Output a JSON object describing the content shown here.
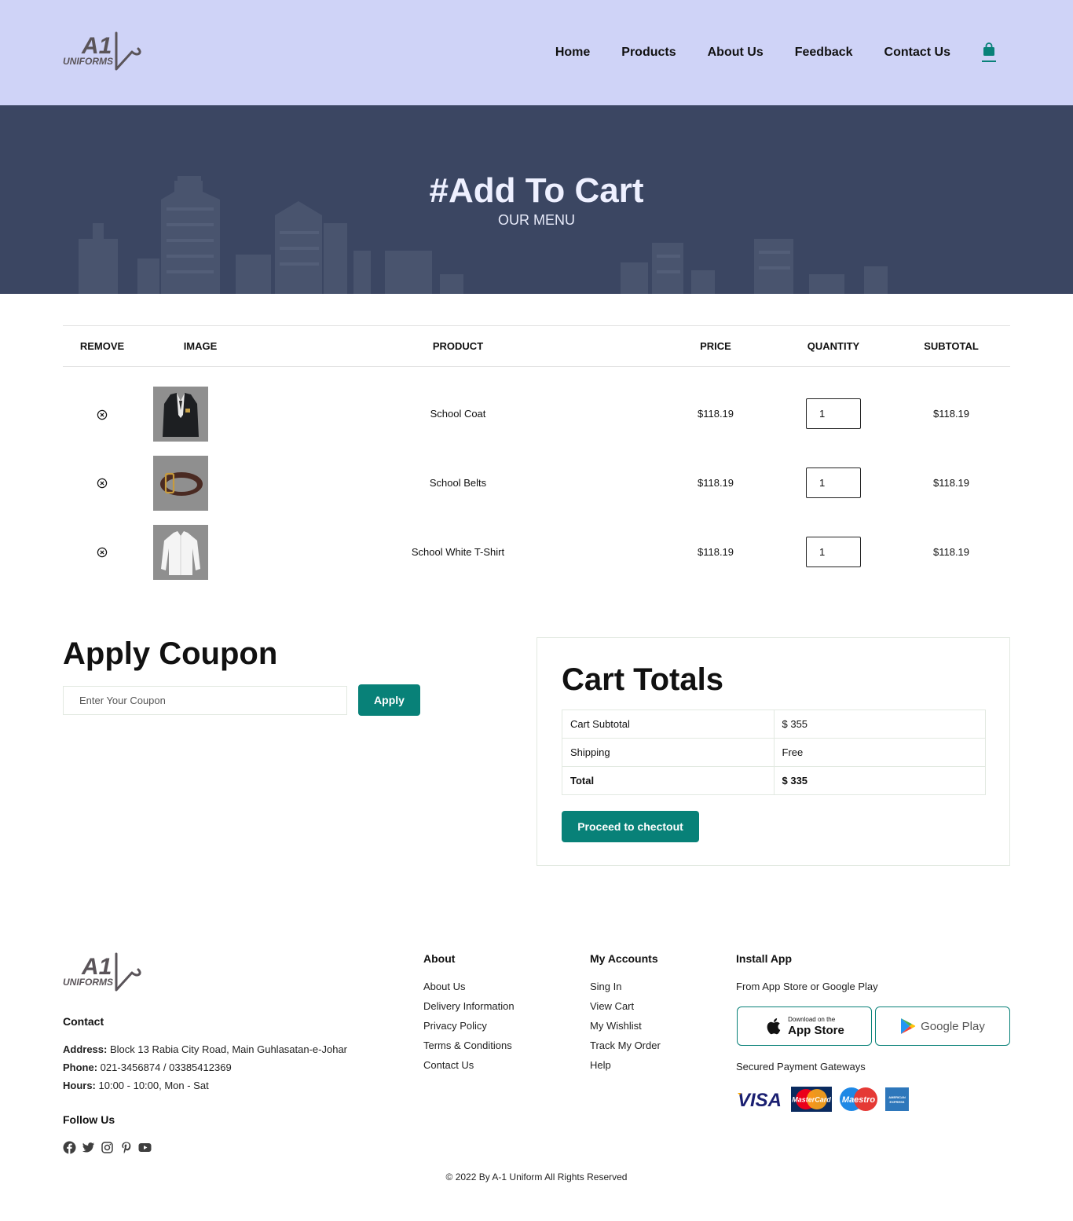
{
  "brand": {
    "logo_big": "A1",
    "logo_small": "UNIFORMS"
  },
  "nav": {
    "items": [
      "Home",
      "Products",
      "About Us",
      "Feedback",
      "Contact Us"
    ],
    "cart_icon": "shopping-bag-icon"
  },
  "hero": {
    "title": "#Add To Cart",
    "subtitle": "OUR MENU"
  },
  "cart": {
    "headers": [
      "REMOVE",
      "IMAGE",
      "PRODUCT",
      "PRICE",
      "QUANTITY",
      "SUBTOTAL"
    ],
    "rows": [
      {
        "product": "School Coat",
        "price": "$118.19",
        "quantity": "1",
        "subtotal": "$118.19",
        "image": "school-coat"
      },
      {
        "product": "School Belts",
        "price": "$118.19",
        "quantity": "1",
        "subtotal": "$118.19",
        "image": "school-belt"
      },
      {
        "product": "School White T-Shirt",
        "price": "$118.19",
        "quantity": "1",
        "subtotal": "$118.19",
        "image": "white-shirt"
      }
    ]
  },
  "coupon": {
    "title": "Apply Coupon",
    "placeholder": "Enter Your Coupon",
    "button": "Apply"
  },
  "totals": {
    "title": "Cart Totals",
    "rows": [
      {
        "label": "Cart Subtotal",
        "value": "$ 355"
      },
      {
        "label": "Shipping",
        "value": "Free"
      },
      {
        "label": "Total",
        "value": "$ 335"
      }
    ],
    "checkout_button": "Proceed to chectout"
  },
  "footer": {
    "contact": {
      "heading": "Contact",
      "address_label": "Address:",
      "address": " Block 13 Rabia City Road, Main Guhlasatan-e-Johar",
      "phone_label": "Phone:",
      "phone": " 021-3456874 / 03385412369",
      "hours_label": "Hours:",
      "hours": " 10:00 - 10:00, Mon - Sat"
    },
    "follow": {
      "heading": "Follow Us",
      "icons": [
        "facebook-icon",
        "twitter-icon",
        "instagram-icon",
        "pinterest-icon",
        "youtube-icon"
      ]
    },
    "about": {
      "heading": "About",
      "links": [
        "About Us",
        "Delivery Information",
        "Privacy Policy",
        "Terms & Conditions",
        "Contact Us"
      ]
    },
    "accounts": {
      "heading": "My Accounts",
      "links": [
        "Sing In",
        "View Cart",
        "My Wishlist",
        "Track My Order",
        "Help"
      ]
    },
    "install": {
      "heading": "Install App",
      "text": "From App Store or Google Play",
      "appstore_small": "Download on the",
      "appstore_big": "App Store",
      "googleplay": "Google Play",
      "payment_text": "Secured Payment Gateways",
      "payment_logos": {
        "visa": "VISA",
        "mastercard": "MasterCard",
        "maestro": "Maestro",
        "amex": "AMERICAN EXPRESS"
      }
    },
    "copyright": "© 2022 By A-1 Uniform All Rights Reserved"
  },
  "colors": {
    "accent": "#088178",
    "header_bg": "#cfd3f7",
    "hero_bg": "#3b4662"
  }
}
